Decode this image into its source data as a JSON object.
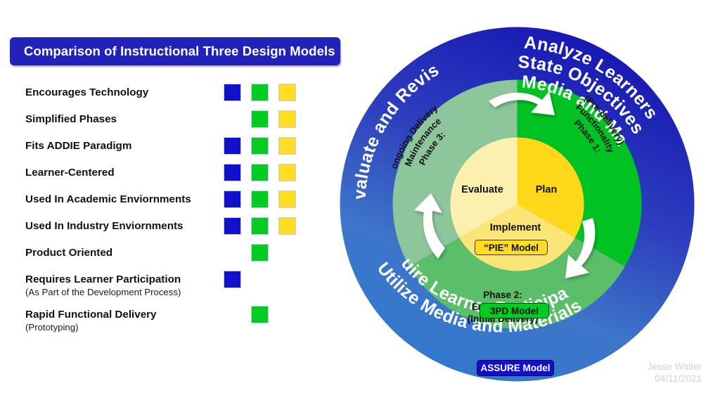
{
  "title": {
    "text": "Comparison of Instructional Three Design Models",
    "background_color": "#2222BB",
    "text_color": "#FFFFFF"
  },
  "legend_colors": {
    "blue": "#1111CC",
    "green": "#00CC22",
    "yellow": "#FFDD22"
  },
  "comparison": {
    "columns": [
      "ASSURE Model",
      "3PD Model",
      "\"PIE\" Model"
    ],
    "rows": [
      {
        "label": "Encourages Technology",
        "sub": "",
        "marks": [
          "blue",
          "green",
          "yellow"
        ]
      },
      {
        "label": "Simplified Phases",
        "sub": "",
        "marks": [
          "none",
          "green",
          "yellow"
        ]
      },
      {
        "label": "Fits ADDIE Paradigm",
        "sub": "",
        "marks": [
          "blue",
          "green",
          "yellow"
        ]
      },
      {
        "label": "Learner-Centered",
        "sub": "",
        "marks": [
          "blue",
          "green",
          "yellow"
        ]
      },
      {
        "label": "Used In Academic Enviornments",
        "sub": "",
        "marks": [
          "blue",
          "green",
          "yellow"
        ]
      },
      {
        "label": "Used In Industry Enviornments",
        "sub": "",
        "marks": [
          "blue",
          "green",
          "yellow"
        ]
      },
      {
        "label": "Product Oriented",
        "sub": "",
        "marks": [
          "none",
          "green",
          "none"
        ]
      },
      {
        "label": "Requires Learner Participation",
        "sub": "(As Part of the Development Process)",
        "marks": [
          "blue",
          "none",
          "none"
        ]
      },
      {
        "label": "Rapid Functional Delivery",
        "sub": "(Prototyping)",
        "marks": [
          "none",
          "green",
          "none"
        ]
      }
    ]
  },
  "diagram": {
    "outer_ring": {
      "segments": [
        {
          "id": "evaluate-revise",
          "lines": [
            "Evaluate and Revise"
          ]
        },
        {
          "id": "analyze-learners",
          "lines": [
            "Analyze Learners",
            "State Objectives",
            "Select Media and Materials"
          ]
        },
        {
          "id": "utilize-media",
          "lines": [
            "Utilize Media and Materials",
            "Require Learner Participation"
          ]
        }
      ]
    },
    "middle_ring": {
      "phase1": {
        "lines": [
          "Phase 1:",
          "Functionality",
          "(Pre-delivery)"
        ]
      },
      "phase2": {
        "lines": [
          "Phase 2:",
          "Enhancement",
          "(Initial Delivery)"
        ]
      },
      "phase3": {
        "lines": [
          "Phase 3:",
          "Maintenance",
          "(ongoing Delivery)"
        ]
      }
    },
    "inner_pie": {
      "slices": [
        {
          "label": "Plan",
          "color": "#FFD819"
        },
        {
          "label": "Implement",
          "color": "#FBE577"
        },
        {
          "label": "Evaluate",
          "color": "#FCF0AE"
        }
      ]
    },
    "badges": {
      "pie": "“PIE” Model",
      "tpd": "3PD Model",
      "assure": "ASSURE Model"
    }
  },
  "signature": {
    "author": "Jesse Walter",
    "date": "04/11/2021"
  }
}
